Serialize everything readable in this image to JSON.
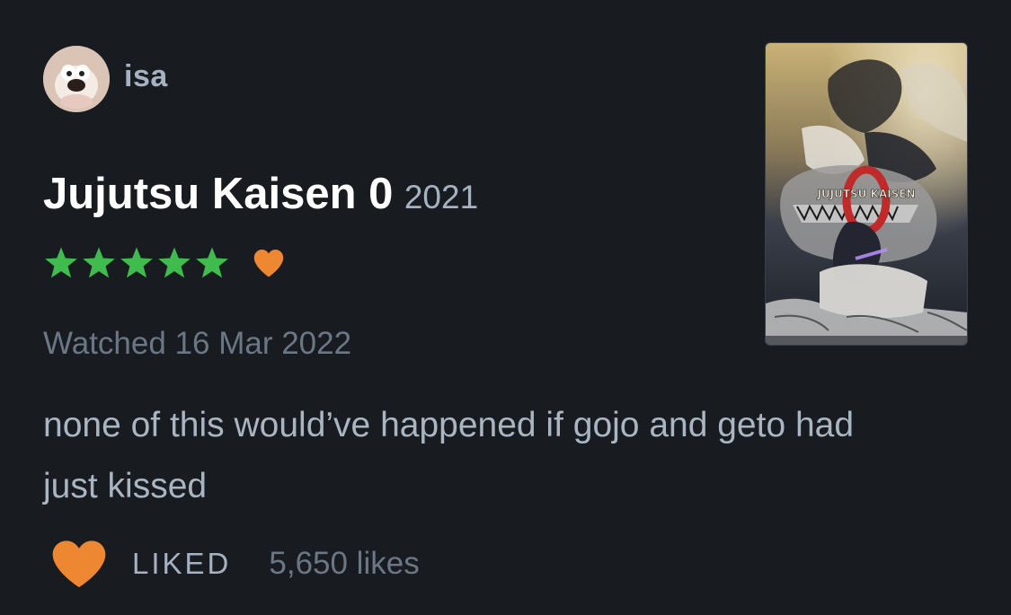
{
  "user": {
    "name": "isa"
  },
  "film": {
    "title": "Jujutsu Kaisen 0",
    "year": "2021",
    "poster_title_text": "JUJUTSU KAISEN",
    "poster_zero": "0"
  },
  "rating": {
    "stars": 5,
    "max_stars": 5,
    "liked": true
  },
  "watched": {
    "text": "Watched 16 Mar 2022"
  },
  "review": {
    "text": "none of this would’ve happened if gojo and geto had just kissed"
  },
  "likes": {
    "liked_label": "LIKED",
    "count_text": "5,650 likes"
  },
  "colors": {
    "background": "#181b20",
    "star_green": "#40bc4f",
    "heart_orange": "#ee8732",
    "title_white": "#ffffff",
    "muted_text": "#6b7784",
    "light_text": "#a6b2c1"
  }
}
